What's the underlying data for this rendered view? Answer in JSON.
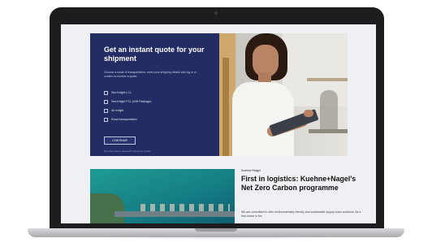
{
  "quote_panel": {
    "title": "Get an instant quote for your shipment",
    "description": "Choose a mode of transportation, enter your shipping details and log in or confirm to receive a quote.",
    "options": [
      "Sea freight LCL",
      "Sea freight FCL (20ft Package)",
      "Air freight",
      "Road transportation"
    ],
    "continue_label": "CONTINUE",
    "footer_text": "Not sure how to proceed? Check our guide"
  },
  "article": {
    "tag": "Kuehne+Nagel",
    "title": "First in logistics: Kuehne+Nagel’s Net Zero Carbon programme",
    "body": "We are committed to offer environmentally friendly and sustainable supply chain solutions. As a first mover in the"
  },
  "colors": {
    "panel_bg": "#232c63",
    "laptop_frame": "#1d1d20",
    "screen_bg": "#eef0f3"
  }
}
